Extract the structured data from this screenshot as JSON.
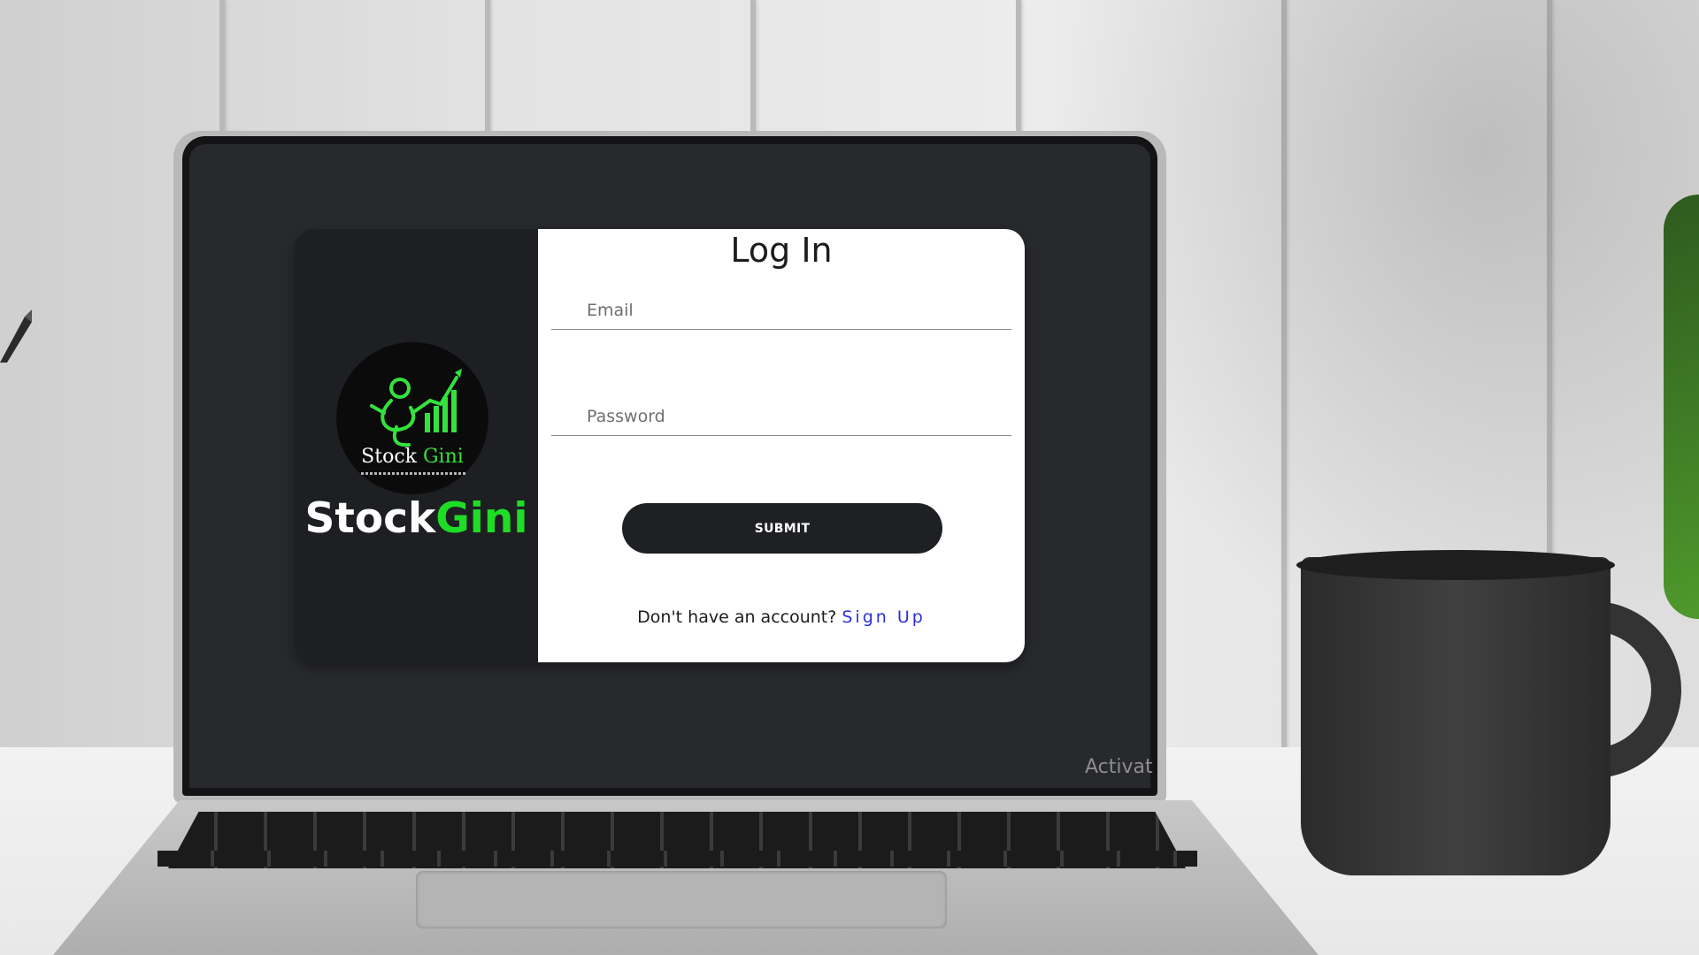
{
  "screen": {
    "watermark": "Activat"
  },
  "brand": {
    "logo_word1": "Stock",
    "logo_word2": "Gini",
    "name_part1": "Stock",
    "name_part2": "Gini",
    "accent_color": "#1fdc26"
  },
  "login": {
    "title": "Log In",
    "email_placeholder": "Email",
    "password_placeholder": "Password",
    "submit_label": "SUBMIT",
    "signup_prompt": "Don't have an account?",
    "signup_link": "Sign Up",
    "link_color": "#2b2fe0"
  }
}
